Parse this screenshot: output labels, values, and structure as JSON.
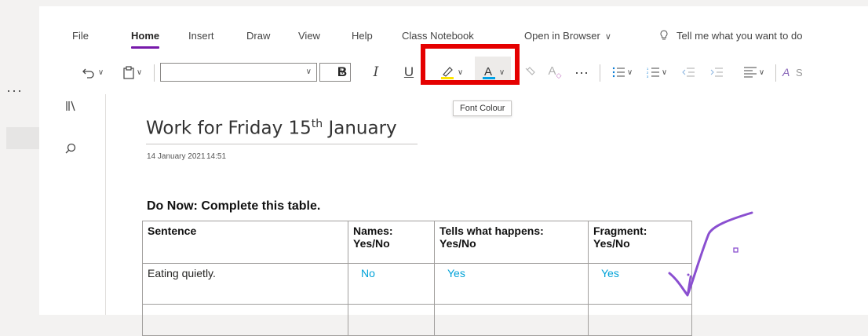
{
  "left": {
    "more": "···"
  },
  "tabs": [
    "File",
    "Home",
    "Insert",
    "Draw",
    "View",
    "Help",
    "Class Notebook",
    "Open in Browser",
    "Tell me what you want to do"
  ],
  "toolbar": {
    "bold": "B",
    "italic": "I",
    "underline": "U",
    "more": "···",
    "font_name": "",
    "font_size": ""
  },
  "tooltip": "Font Colour",
  "colors": {
    "highlight_yellow": "#ffe600",
    "font_blue": "#00a2e8",
    "accent_purple": "#7719aa",
    "callout_red": "#e50000",
    "answer_cyan": "#00a2d8",
    "tick_purple": "#8a4fd0"
  },
  "icons": [
    "undo-icon",
    "clipboard-icon",
    "highlighter-icon",
    "font-colour-icon",
    "format-painter-icon",
    "clear-format-icon",
    "bullets-icon",
    "numbering-icon",
    "outdent-icon",
    "indent-icon",
    "align-icon",
    "styles-icon",
    "notebooks-icon",
    "search-icon",
    "lightbulb-icon"
  ],
  "page": {
    "title_main": "Work for Friday 15",
    "title_sup": "th",
    "title_end": " January",
    "date": "14 January 2021",
    "time": "14:51",
    "heading": "Do Now: Complete this table.",
    "table": {
      "headers": [
        [
          "Sentence",
          ""
        ],
        [
          "Names:",
          "Yes/No"
        ],
        [
          "Tells what happens:",
          "Yes/No"
        ],
        [
          "Fragment:",
          "Yes/No"
        ]
      ],
      "rows": [
        [
          "Eating quietly.",
          "No",
          "Yes",
          "Yes"
        ],
        [
          "",
          "",
          "",
          ""
        ]
      ]
    }
  }
}
